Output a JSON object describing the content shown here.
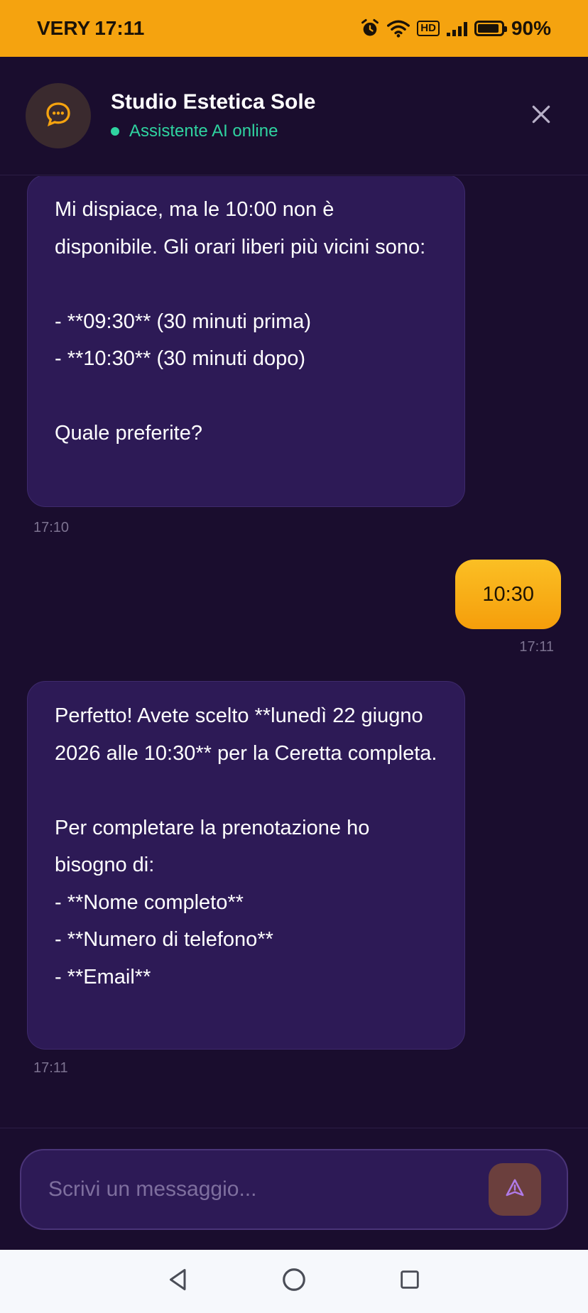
{
  "status_bar": {
    "carrier": "VERY",
    "time": "17:11",
    "hd_label": "HD",
    "battery": "90%",
    "battery_level": 0.9
  },
  "header": {
    "title": "Studio Estetica Sole",
    "status": "Assistente AI online",
    "avatar_icon": "chat-bubble-icon",
    "close_icon": "close-icon"
  },
  "messages": [
    {
      "sender": "bot",
      "text": "Mi dispiace, ma le 10:00 non è disponibile. Gli orari liberi più vicini sono:\n\n- **09:30** (30 minuti prima)\n- **10:30** (30 minuti dopo)\n\nQuale preferite?",
      "time": "17:10"
    },
    {
      "sender": "user",
      "text": "10:30",
      "time": "17:11"
    },
    {
      "sender": "bot",
      "text": "Perfetto! Avete scelto **lunedì 22 giugno 2026 alle 10:30** per la Ceretta completa.\n\nPer completare la prenotazione ho bisogno di:\n- **Nome completo**\n- **Numero di telefono**\n- **Email**",
      "time": "17:11"
    }
  ],
  "composer": {
    "placeholder": "Scrivi un messaggio...",
    "value": "",
    "send_icon": "send-icon"
  },
  "colors": {
    "accent": "#f5a30f",
    "background": "#1a0d2e",
    "bubble_bot": "#2d1a56",
    "online": "#2fd3a0"
  }
}
